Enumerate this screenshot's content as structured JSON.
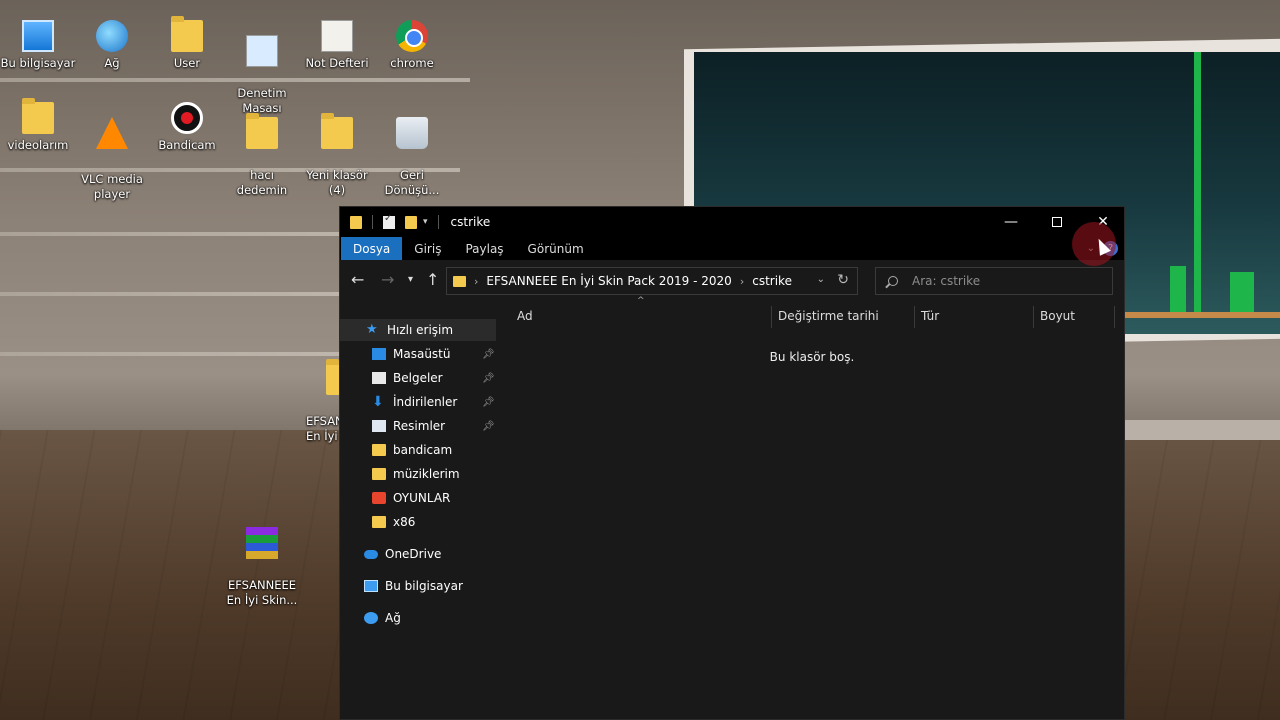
{
  "desktop": {
    "icons": [
      {
        "label": "Bu bilgisayar",
        "icon": "this-pc-icon"
      },
      {
        "label": "Ağ",
        "icon": "network-icon"
      },
      {
        "label": "User",
        "icon": "user-folder-icon"
      },
      {
        "label": "Denetim\nMasası",
        "icon": "control-panel-icon"
      },
      {
        "label": "Not Defteri",
        "icon": "notepad-icon"
      },
      {
        "label": "chrome",
        "icon": "chrome-icon"
      },
      {
        "label": "videolarım",
        "icon": "folder-icon"
      },
      {
        "label": "VLC media\nplayer",
        "icon": "vlc-icon"
      },
      {
        "label": "Bandicam",
        "icon": "bandicam-icon"
      },
      {
        "label": "hacı\ndedemin",
        "icon": "folder-icon"
      },
      {
        "label": "Yeni klasör\n(4)",
        "icon": "folder-icon"
      },
      {
        "label": "Geri\nDönüşü...",
        "icon": "recycle-bin-icon"
      },
      {
        "label": "EFSANNEEE\nEn İyi Skin...",
        "icon": "winrar-archive-icon"
      },
      {
        "label": "EFSAN\nEn İyi",
        "icon": "folder-icon"
      }
    ]
  },
  "window": {
    "title": "cstrike",
    "ribbon_tabs": [
      "Dosya",
      "Giriş",
      "Paylaş",
      "Görünüm"
    ],
    "breadcrumbs": [
      "EFSANNEEE En İyi Skin Pack 2019 - 2020",
      "cstrike"
    ],
    "search_placeholder": "Ara: cstrike",
    "nav": {
      "quick_access": "Hızlı erişim",
      "pinned": [
        "Masaüstü",
        "Belgeler",
        "İndirilenler",
        "Resimler"
      ],
      "folders": [
        "bandicam",
        "müziklerim",
        "OYUNLAR",
        "x86"
      ],
      "onedrive": "OneDrive",
      "this_pc": "Bu bilgisayar",
      "network": "Ağ"
    },
    "columns": [
      "Ad",
      "Değiştirme tarihi",
      "Tür",
      "Boyut"
    ],
    "empty_message": "Bu klasör boş."
  },
  "colors": {
    "window_bg": "#191919",
    "titlebar_bg": "#000000",
    "file_tab": "#1a6fbf",
    "folder_yellow": "#f3c94e"
  }
}
